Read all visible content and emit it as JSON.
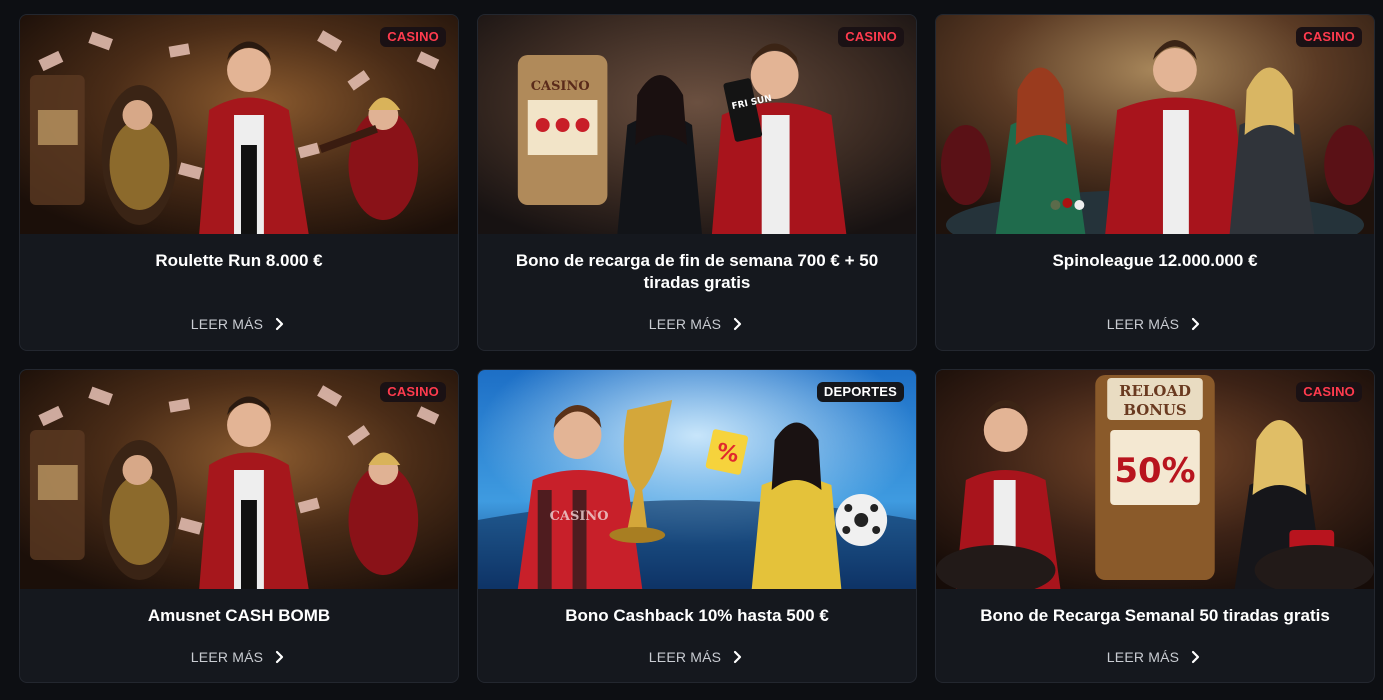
{
  "promotions": [
    {
      "title": "Roulette Run 8.000 €",
      "badge": "CASINO",
      "read_more": "LEER MÁS",
      "image": "casino-man-red-jacket-money-rain"
    },
    {
      "title": "Bono de recarga de fin de semana 700 € + 50 tiradas gratis",
      "badge": "CASINO",
      "read_more": "LEER MÁS",
      "image": "casino-couple-slot-machine",
      "art_text": "CASINO",
      "card_text": "FRI SUN"
    },
    {
      "title": "Spinoleague 12.000.000 €",
      "badge": "CASINO",
      "read_more": "LEER MÁS",
      "image": "poker-table-trio"
    },
    {
      "title": "Amusnet CASH BOMB",
      "badge": "CASINO",
      "read_more": "LEER MÁS",
      "image": "casino-man-red-jacket-money-rain"
    },
    {
      "title": "Bono Cashback 10% hasta 500 €",
      "badge": "DEPORTES",
      "read_more": "LEER MÁS",
      "image": "football-trophy-stadium",
      "art_text": "CASINO",
      "sign_text": "%"
    },
    {
      "title": "Bono de Recarga Semanal 50 tiradas gratis",
      "badge": "CASINO",
      "read_more": "LEER MÁS",
      "image": "reload-bonus-slot-machine",
      "art_line1": "RELOAD",
      "art_line2": "BONUS",
      "art_percent": "50%"
    }
  ],
  "colors": {
    "page_bg": "#0d0f13",
    "card_bg": "#15181e",
    "casino_badge": "#ff3b4e",
    "title_text": "#ffffff",
    "read_more_text": "#c9ccd2"
  },
  "icons": {
    "read_more": "chevron-right-icon"
  }
}
